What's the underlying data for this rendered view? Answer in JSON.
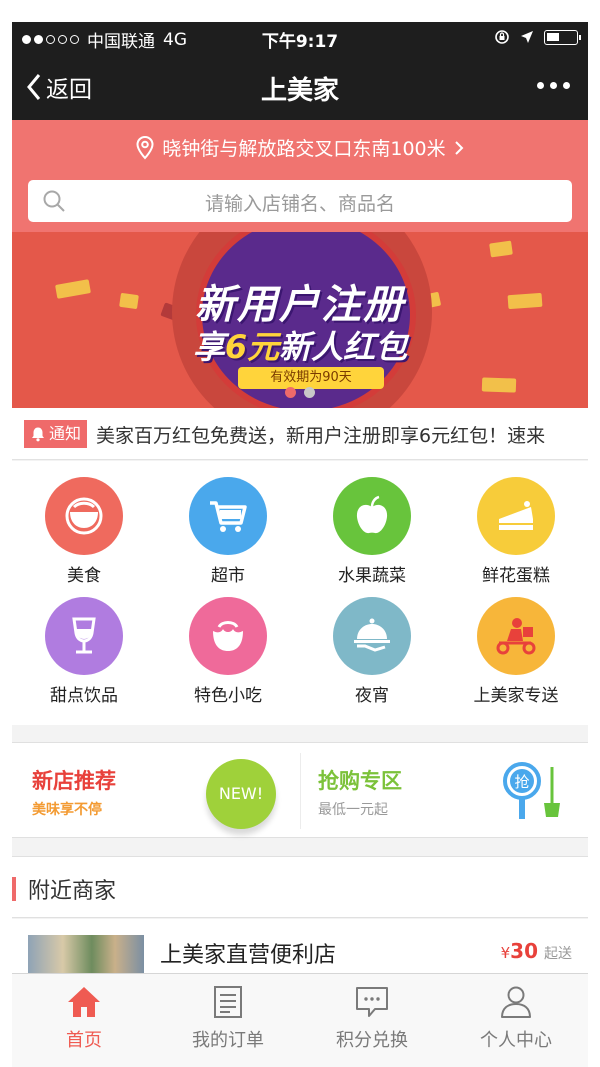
{
  "status_bar": {
    "carrier": "中国联通",
    "network": "4G",
    "time": "下午9:17",
    "signal_bars": 2,
    "battery_level": 0.45
  },
  "nav": {
    "back_label": "返回",
    "title": "上美家"
  },
  "location": {
    "text": "晓钟街与解放路交叉口东南100米"
  },
  "search": {
    "placeholder": "请输入店铺名、商品名"
  },
  "banner": {
    "line1": "新用户注册",
    "line2_prefix": "享",
    "line2_highlight": "6元",
    "line2_suffix": "新人红包",
    "validity": "有效期为90天",
    "page_count": 2,
    "active_page": 1
  },
  "notice": {
    "tag": "通知",
    "text": "美家百万红包免费送，新用户注册即享6元红包！速来"
  },
  "categories": [
    {
      "label": "美食",
      "icon": "bowl-icon",
      "color": "#ef6a5e"
    },
    {
      "label": "超市",
      "icon": "cart-icon",
      "color": "#4aa8ec"
    },
    {
      "label": "水果蔬菜",
      "icon": "apple-icon",
      "color": "#68c43c"
    },
    {
      "label": "鲜花蛋糕",
      "icon": "cake-icon",
      "color": "#f7cc3a"
    },
    {
      "label": "甜点饮品",
      "icon": "wine-glass-icon",
      "color": "#b07ce0"
    },
    {
      "label": "特色小吃",
      "icon": "dumpling-icon",
      "color": "#ef6a9a"
    },
    {
      "label": "夜宵",
      "icon": "cloche-icon",
      "color": "#7fb8c8"
    },
    {
      "label": "上美家专送",
      "icon": "delivery-scooter-icon",
      "color": "#f7b63a"
    }
  ],
  "promo": {
    "new_store_title": "新店推荐",
    "new_store_subtitle": "美味享不停",
    "new_badge": "NEW!",
    "flash_title": "抢购专区",
    "flash_subtitle": "最低一元起",
    "grab_char": "抢"
  },
  "nearby": {
    "title": "附近商家"
  },
  "shop": {
    "name": "上美家直营便利店",
    "price_symbol": "¥",
    "min_price": "30",
    "min_suffix": "起送"
  },
  "tabs": [
    {
      "label": "首页",
      "icon": "home-icon",
      "active": true
    },
    {
      "label": "我的订单",
      "icon": "order-list-icon",
      "active": false
    },
    {
      "label": "积分兑换",
      "icon": "chat-bubble-icon",
      "active": false
    },
    {
      "label": "个人中心",
      "icon": "user-icon",
      "active": false
    }
  ],
  "colors": {
    "accent": "#ef6a6a",
    "nav_bg": "#1e1e1e",
    "location_bg": "#f07470",
    "banner_bg": "#e4584a"
  }
}
